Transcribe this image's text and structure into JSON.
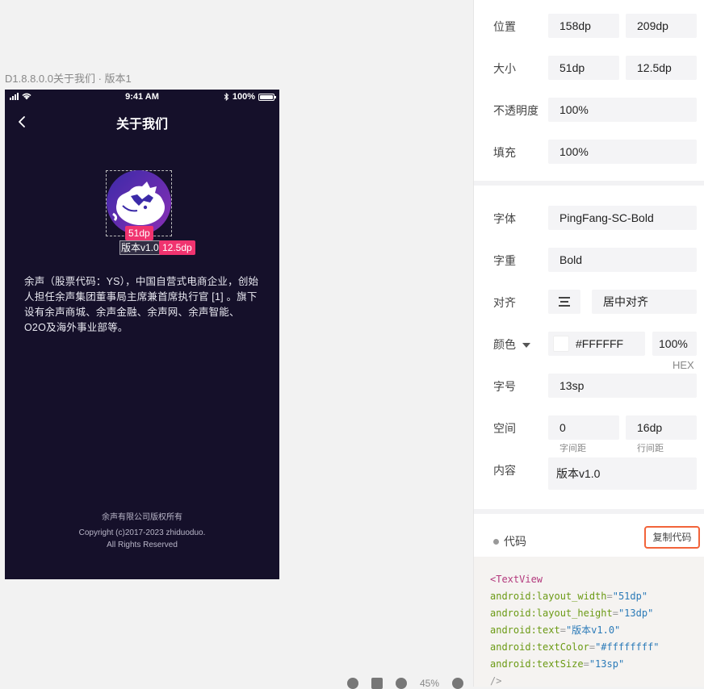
{
  "artboard": {
    "label": "D1.8.8.0.0关于我们 · 版本1"
  },
  "phone": {
    "status_time": "9:41 AM",
    "status_battery": "100%",
    "title": "关于我们",
    "measure_width": "51dp",
    "measure_height": "12.5dp",
    "version_text": "版本v1.0",
    "description": "余声（股票代码：YS），中国自营式电商企业，创始人担任余声集团董事局主席兼首席执行官 [1] 。旗下设有余声商城、余声金融、余声网、余声智能、O2O及海外事业部等。",
    "footer_line1": "余声有限公司版权所有",
    "footer_line2": "Copyright (c)2017-2023   zhiduoduo.",
    "footer_line3": "All Rights Reserved"
  },
  "toolbar": {
    "zoom": "45%"
  },
  "panel": {
    "position": {
      "label": "位置",
      "x": "158dp",
      "y": "209dp"
    },
    "size": {
      "label": "大小",
      "w": "51dp",
      "h": "12.5dp"
    },
    "opacity": {
      "label": "不透明度",
      "value": "100%"
    },
    "fill": {
      "label": "填充",
      "value": "100%"
    },
    "font": {
      "label": "字体",
      "value": "PingFang-SC-Bold"
    },
    "weight": {
      "label": "字重",
      "value": "Bold"
    },
    "align": {
      "label": "对齐",
      "value": "居中对齐"
    },
    "color": {
      "label": "颜色",
      "hex": "#FFFFFF",
      "alpha": "100%",
      "mode": "HEX"
    },
    "font_size": {
      "label": "字号",
      "value": "13sp"
    },
    "spacing": {
      "label": "空间",
      "letter": "0",
      "line": "16dp",
      "letter_label": "字间距",
      "line_label": "行间距"
    },
    "content": {
      "label": "内容",
      "value": "版本v1.0"
    },
    "code": {
      "title": "代码",
      "copy_label": "复制代码",
      "tag_open": "<TextView",
      "attrs": [
        {
          "name": "android:layout_width",
          "value": "\"51dp\""
        },
        {
          "name": "android:layout_height",
          "value": "\"13dp\""
        },
        {
          "name": "android:text",
          "value": "\"版本v1.0\""
        },
        {
          "name": "android:textColor",
          "value": "\"#ffffffff\""
        },
        {
          "name": "android:textSize",
          "value": "\"13sp\""
        }
      ],
      "tag_close": "/>"
    }
  }
}
